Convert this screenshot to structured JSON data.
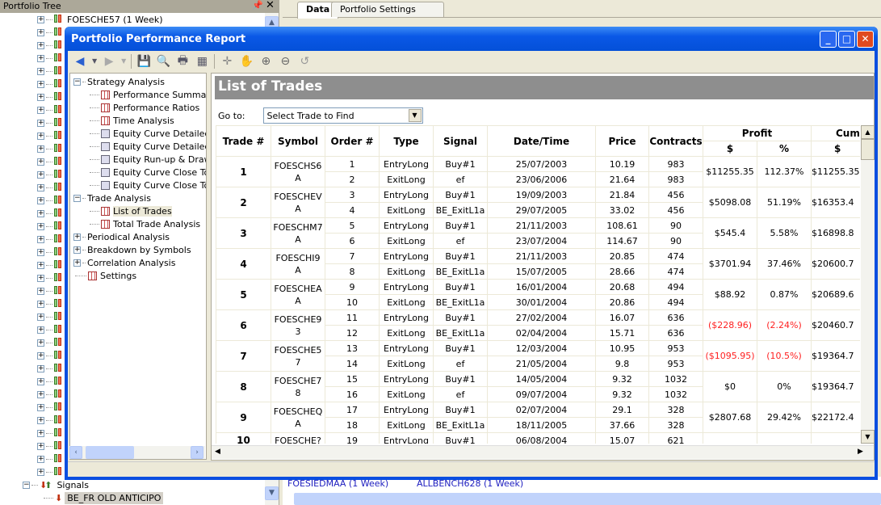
{
  "portfolio_tree": {
    "title": "Portfolio Tree",
    "first_item": "FOESCHE57 (1 Week)",
    "signals_label": "Signals",
    "signal_item": "BE_FR OLD ANTICIPO"
  },
  "tabs": [
    {
      "label": "Data",
      "active": true
    },
    {
      "label": "Portfolio Settings",
      "active": false
    }
  ],
  "background_list": {
    "row": [
      "FOESIEDMAA (1 Week)",
      "ALLBENCH628 (1 Week)"
    ]
  },
  "dialog": {
    "title": "Portfolio Performance Report",
    "toolbar_icons": [
      "back-icon",
      "forward-icon",
      "save-icon",
      "preview-icon",
      "print-icon",
      "table-icon",
      "crosshair-icon",
      "hand-icon",
      "zoom-in-icon",
      "zoom-out-icon",
      "reset-icon"
    ],
    "nav": [
      {
        "label": "Strategy Analysis",
        "level": 0,
        "expander": "-"
      },
      {
        "label": "Performance Summary",
        "level": 1,
        "icon": "grid"
      },
      {
        "label": "Performance Ratios",
        "level": 1,
        "icon": "grid"
      },
      {
        "label": "Time Analysis",
        "level": 1,
        "icon": "grid"
      },
      {
        "label": "Equity Curve Detailed",
        "level": 1,
        "icon": "chart"
      },
      {
        "label": "Equity Curve Detailed w",
        "level": 1,
        "icon": "chart"
      },
      {
        "label": "Equity Run-up & Drawdo",
        "level": 1,
        "icon": "chart"
      },
      {
        "label": "Equity Curve Close To C",
        "level": 1,
        "icon": "chart"
      },
      {
        "label": "Equity Curve Close To C",
        "level": 1,
        "icon": "chart"
      },
      {
        "label": "Trade Analysis",
        "level": 0,
        "expander": "-"
      },
      {
        "label": "List of Trades",
        "level": 1,
        "icon": "grid",
        "selected": true
      },
      {
        "label": "Total Trade Analysis",
        "level": 1,
        "icon": "grid"
      },
      {
        "label": "Periodical Analysis",
        "level": 0,
        "expander": "+"
      },
      {
        "label": "Breakdown by Symbols",
        "level": 0,
        "expander": "+"
      },
      {
        "label": "Correlation Analysis",
        "level": 0,
        "expander": "+"
      },
      {
        "label": "Settings",
        "level": 0,
        "icon": "grid"
      }
    ],
    "report_title": "List of Trades",
    "goto_label": "Go to:",
    "goto_value": "Select Trade to Find",
    "headers": {
      "trade": "Trade #",
      "symbol": "Symbol",
      "order": "Order #",
      "type": "Type",
      "signal": "Signal",
      "datetime": "Date/Time",
      "price": "Price",
      "contracts": "Contracts",
      "profit": "Profit",
      "cum": "Cum",
      "dollar": "$",
      "percent": "%"
    },
    "trades": [
      {
        "n": "1",
        "symbol": "FOESCHS6A",
        "profit": "$11255.35",
        "pct": "112.37%",
        "cum": "$11255.35",
        "neg": false,
        "orders": [
          [
            "1",
            "EntryLong",
            "Buy#1",
            "25/07/2003",
            "10.19",
            "983"
          ],
          [
            "2",
            "ExitLong",
            "ef",
            "23/06/2006",
            "21.64",
            "983"
          ]
        ]
      },
      {
        "n": "2",
        "symbol": "FOESCHEVA",
        "profit": "$5098.08",
        "pct": "51.19%",
        "cum": "$16353.4",
        "neg": false,
        "orders": [
          [
            "3",
            "EntryLong",
            "Buy#1",
            "19/09/2003",
            "21.84",
            "456"
          ],
          [
            "4",
            "ExitLong",
            "BE_ExitL1a",
            "29/07/2005",
            "33.02",
            "456"
          ]
        ]
      },
      {
        "n": "3",
        "symbol": "FOESCHM7A",
        "profit": "$545.4",
        "pct": "5.58%",
        "cum": "$16898.8",
        "neg": false,
        "orders": [
          [
            "5",
            "EntryLong",
            "Buy#1",
            "21/11/2003",
            "108.61",
            "90"
          ],
          [
            "6",
            "ExitLong",
            "ef",
            "23/07/2004",
            "114.67",
            "90"
          ]
        ]
      },
      {
        "n": "4",
        "symbol": "FOESCHI9A",
        "profit": "$3701.94",
        "pct": "37.46%",
        "cum": "$20600.7",
        "neg": false,
        "orders": [
          [
            "7",
            "EntryLong",
            "Buy#1",
            "21/11/2003",
            "20.85",
            "474"
          ],
          [
            "8",
            "ExitLong",
            "BE_ExitL1a",
            "15/07/2005",
            "28.66",
            "474"
          ]
        ]
      },
      {
        "n": "5",
        "symbol": "FOESCHEAA",
        "profit": "$88.92",
        "pct": "0.87%",
        "cum": "$20689.6",
        "neg": false,
        "orders": [
          [
            "9",
            "EntryLong",
            "Buy#1",
            "16/01/2004",
            "20.68",
            "494"
          ],
          [
            "10",
            "ExitLong",
            "BE_ExitL1a",
            "30/01/2004",
            "20.86",
            "494"
          ]
        ]
      },
      {
        "n": "6",
        "symbol": "FOESCHE93",
        "profit": "($228.96)",
        "pct": "(2.24%)",
        "cum": "$20460.7",
        "neg": true,
        "orders": [
          [
            "11",
            "EntryLong",
            "Buy#1",
            "27/02/2004",
            "16.07",
            "636"
          ],
          [
            "12",
            "ExitLong",
            "BE_ExitL1a",
            "02/04/2004",
            "15.71",
            "636"
          ]
        ]
      },
      {
        "n": "7",
        "symbol": "FOESCHE57",
        "profit": "($1095.95)",
        "pct": "(10.5%)",
        "cum": "$19364.7",
        "neg": true,
        "orders": [
          [
            "13",
            "EntryLong",
            "Buy#1",
            "12/03/2004",
            "10.95",
            "953"
          ],
          [
            "14",
            "ExitLong",
            "ef",
            "21/05/2004",
            "9.8",
            "953"
          ]
        ]
      },
      {
        "n": "8",
        "symbol": "FOESCHE78",
        "profit": "$0",
        "pct": "0%",
        "cum": "$19364.7",
        "neg": false,
        "orders": [
          [
            "15",
            "EntryLong",
            "Buy#1",
            "14/05/2004",
            "9.32",
            "1032"
          ],
          [
            "16",
            "ExitLong",
            "ef",
            "09/07/2004",
            "9.32",
            "1032"
          ]
        ]
      },
      {
        "n": "9",
        "symbol": "FOESCHEQA",
        "profit": "$2807.68",
        "pct": "29.42%",
        "cum": "$22172.4",
        "neg": false,
        "orders": [
          [
            "17",
            "EntryLong",
            "Buy#1",
            "02/07/2004",
            "29.1",
            "328"
          ],
          [
            "18",
            "ExitLong",
            "BE_ExitL1a",
            "18/11/2005",
            "37.66",
            "328"
          ]
        ]
      },
      {
        "n": "10",
        "symbol": "FOESCHE?",
        "profit": "",
        "pct": "",
        "cum": "",
        "neg": false,
        "orders": [
          [
            "19",
            "EntryLong",
            "Buy#1",
            "06/08/2004",
            "15.07",
            "621"
          ]
        ]
      }
    ]
  },
  "colors": {
    "titlebar": "#0a58e6",
    "report_header": "#8e8e8e",
    "negative": "#ff2020",
    "grid": "#ece9d8"
  }
}
